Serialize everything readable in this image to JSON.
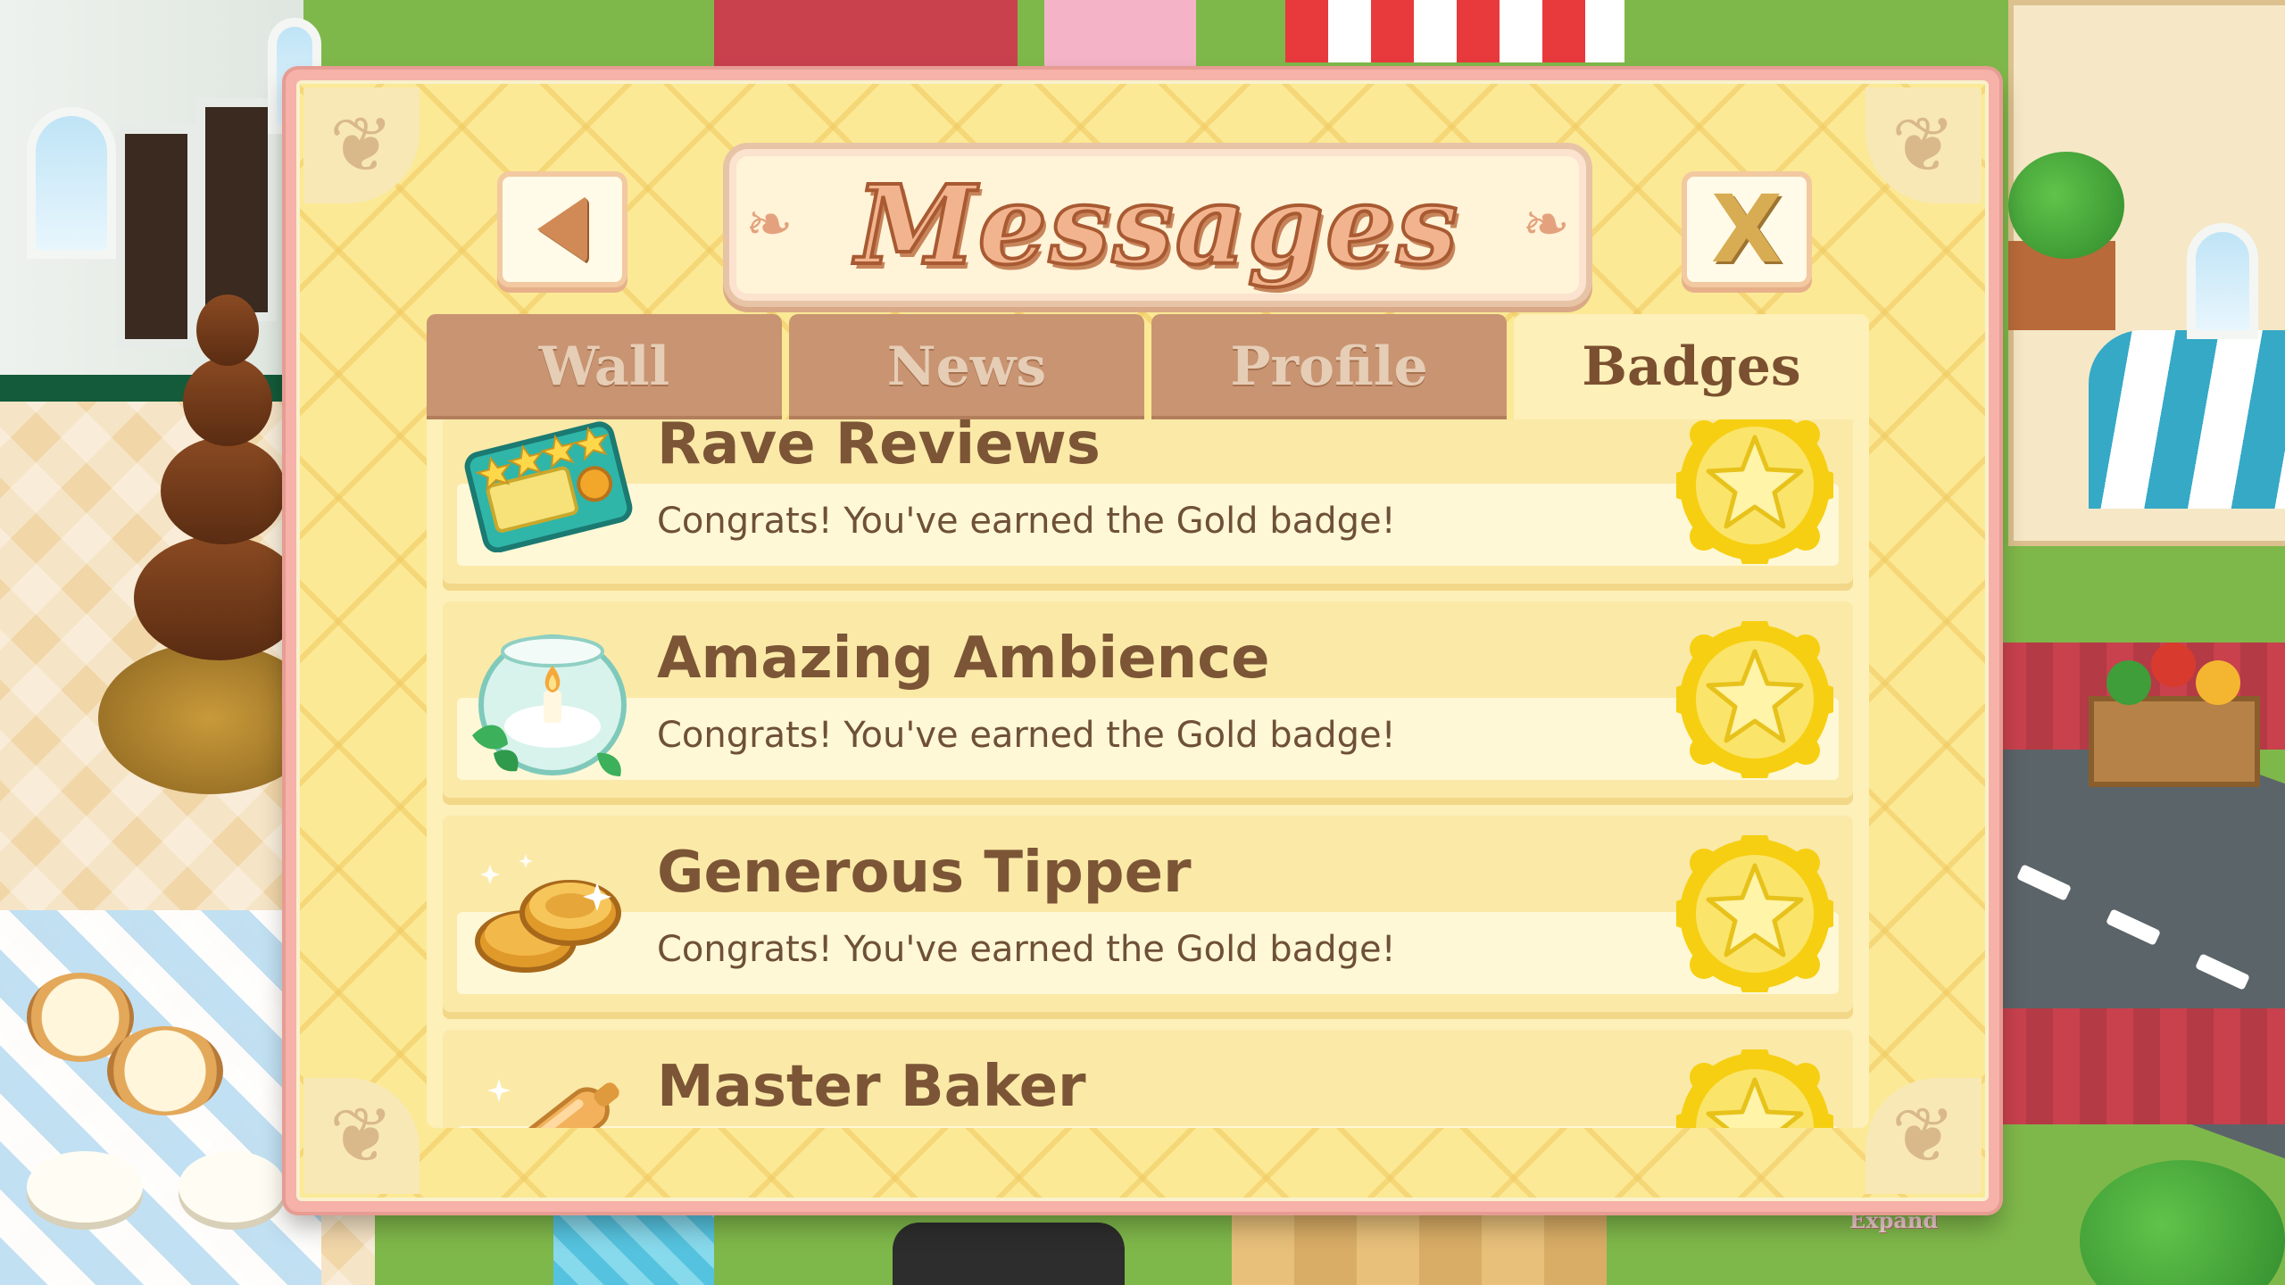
{
  "dialog": {
    "title": "Messages",
    "close_label": "X"
  },
  "tabs": [
    {
      "label": "Wall",
      "active": false
    },
    {
      "label": "News",
      "active": false
    },
    {
      "label": "Profile",
      "active": false
    },
    {
      "label": "Badges",
      "active": true
    }
  ],
  "badges": [
    {
      "title": "Rave Reviews",
      "description": "Congrats! You've earned the Gold badge!",
      "icon": "review-card-icon",
      "medal": "gold-star-medal-icon"
    },
    {
      "title": "Amazing Ambience",
      "description": "Congrats! You've earned the Gold badge!",
      "icon": "candle-bowl-icon",
      "medal": "gold-star-medal-icon"
    },
    {
      "title": "Generous Tipper",
      "description": "Congrats! You've earned the Gold badge!",
      "icon": "gold-coins-icon",
      "medal": "gold-star-medal-icon"
    },
    {
      "title": "Master Baker",
      "description": "",
      "icon": "rolling-pin-icon",
      "medal": "gold-star-medal-icon"
    }
  ],
  "scene": {
    "expand_label": "Expand"
  },
  "colors": {
    "dialog_frame": "#f6b1a9",
    "dialog_bg": "#fbe995",
    "tab_inactive": "#c89472",
    "tab_active": "#fdf0b8",
    "text_brown": "#7b5536",
    "medal_gold": "#f7d21a"
  }
}
